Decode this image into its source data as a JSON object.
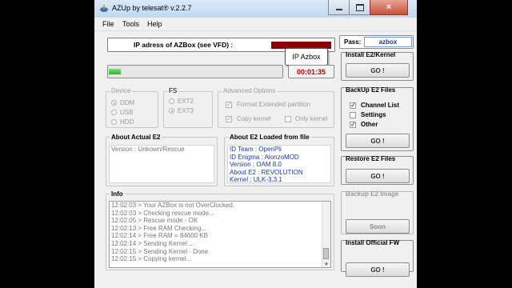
{
  "window": {
    "title": "AZUp by telesat®   v.2.2.7"
  },
  "menu": [
    "File",
    "Tools",
    "Help"
  ],
  "ip": {
    "label": "IP adress of AZBox (see VFD) :",
    "tooltip": "IP Azbox"
  },
  "progress": {
    "fraction": 0.07,
    "time": "00:01:35"
  },
  "pass": {
    "label": "Pass:",
    "value": "azbox"
  },
  "device": {
    "title": "Device",
    "options": [
      "DDM",
      "USB",
      "HDD"
    ],
    "selected": 0
  },
  "fs": {
    "title": "FS",
    "options": [
      "EXT2",
      "EXT3"
    ],
    "selected": 1
  },
  "advanced": {
    "title": "Advanced Options",
    "format": "Format Extended partition",
    "copy_kernel": "Copy kernel",
    "only_kernel": "Only kernel"
  },
  "right_panel": {
    "install_e2": {
      "title": "Install E2/Kernel",
      "button": "GO !"
    },
    "backup_e2": {
      "title": "BackUp E2 Files",
      "button": "GO !",
      "items": [
        {
          "label": "Channel List",
          "checked": true
        },
        {
          "label": "Settings",
          "checked": false
        },
        {
          "label": "Other",
          "checked": true
        }
      ]
    },
    "restore_e2": {
      "title": "Restore E2 Files",
      "button": "GO !"
    },
    "backup_image": {
      "title": "Backup E2 Image",
      "button": "Soon"
    },
    "install_fw": {
      "title": "Install Official FW",
      "button": "GO !"
    }
  },
  "actual_e2": {
    "title": "About Actual E2",
    "version": "Version : Unkown/Rescue"
  },
  "loaded_e2": {
    "title": "About E2 Loaded from file",
    "lines": [
      "ID Team : OpenPli",
      "ID Enigma : AlonzoMOD",
      "Version : OAM 8.0",
      "About E2 : REVOLUTION",
      "Kernel : ULK-3.3.1"
    ]
  },
  "info": {
    "title": "Info",
    "lines": [
      "12:02:03 > Your AZBox is not OverClocked.",
      "12:02:03 > Checking rescue mode...",
      "12:02:05 > Rescue mode - OK",
      "12:02:13 > Free RAM Checking...",
      "12:02:14 > Free RAM = 84600 KB",
      "12:02:14 > Sending Kernel ...",
      "12:02:15 > Sending Kernel - Done",
      "12:02:15 > Copying kernel..."
    ]
  },
  "colors": {
    "progress_green": "#3cc83c",
    "timer_red": "#b80000",
    "ip_red": "#8b0000",
    "info_text": "#777777",
    "loaded_text": "#1a3c9c"
  }
}
